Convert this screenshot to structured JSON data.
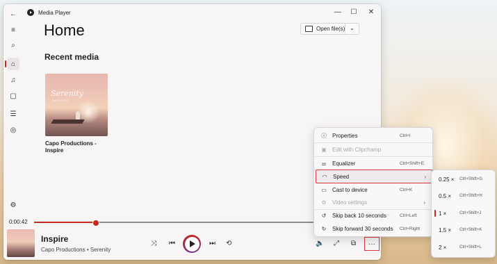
{
  "app": {
    "title": "Media Player"
  },
  "window_controls": {
    "minimize": "—",
    "maximize": "☐",
    "close": "✕"
  },
  "sidebar": {
    "back": "←",
    "menu": "≡",
    "search": "⌕",
    "home": "⌂",
    "music": "♫",
    "video": "▢",
    "playlists": "☰",
    "queue": "◎",
    "settings": "⚙"
  },
  "header": {
    "page_title": "Home",
    "open_files_label": "Open file(s)",
    "open_files_chevron": "⌄"
  },
  "recent": {
    "section_title": "Recent media",
    "items": [
      {
        "title": "Capo Productions - Inspire",
        "art_title": "Serenity",
        "art_sub": "CAPO PRO"
      }
    ]
  },
  "player": {
    "elapsed": "0:00:42",
    "progress": 0.21,
    "track_title": "Inspire",
    "track_subtitle": "Capo Productions • Serenity",
    "shuffle": "⤨",
    "prev": "⏮",
    "next": "⏭",
    "repeat": "⟲",
    "volume": "🔈",
    "fullscreen": "⤢",
    "miniplayer": "⧉",
    "more": "···"
  },
  "context_menu": {
    "items": [
      {
        "icon": "ⓘ",
        "label": "Properties",
        "shortcut": "Ctrl+I"
      },
      {
        "icon": "▣",
        "label": "Edit with Clipchamp",
        "shortcut": ""
      },
      {
        "icon": "⚌",
        "label": "Equalizer",
        "shortcut": "Ctrl+Shift+E"
      },
      {
        "icon": "◠",
        "label": "Speed",
        "shortcut": "",
        "arrow": "›"
      },
      {
        "icon": "▭",
        "label": "Cast to device",
        "shortcut": "Ctrl+K"
      },
      {
        "icon": "⚙",
        "label": "Video settings",
        "shortcut": "",
        "arrow": "›"
      },
      {
        "icon": "↺",
        "label": "Skip back 10 seconds",
        "shortcut": "Ctrl+Left"
      },
      {
        "icon": "↻",
        "label": "Skip forward 30 seconds",
        "shortcut": "Ctrl+Right"
      }
    ]
  },
  "speed_menu": {
    "items": [
      {
        "label": "0.25 ×",
        "shortcut": "Ctrl+Shift+G"
      },
      {
        "label": "0.5 ×",
        "shortcut": "Ctrl+Shift+H"
      },
      {
        "label": "1 ×",
        "shortcut": "Ctrl+Shift+J"
      },
      {
        "label": "1.5 ×",
        "shortcut": "Ctrl+Shift+K"
      },
      {
        "label": "2 ×",
        "shortcut": "Ctrl+Shift+L"
      }
    ],
    "selected_index": 2
  },
  "colors": {
    "accent": "#c42b1c",
    "highlight_border": "#d8363a"
  }
}
